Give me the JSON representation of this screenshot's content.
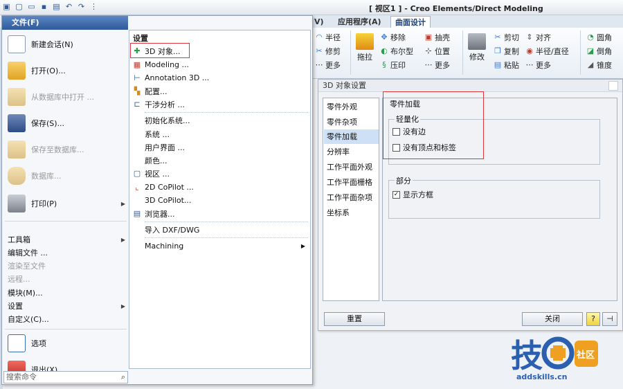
{
  "app": {
    "title": "[ 视区1 ] - Creo Elements/Direct Modeling"
  },
  "ribbon": {
    "tabs": [
      {
        "label": "V)"
      },
      {
        "label": "应用程序(A)"
      },
      {
        "label": "曲面设计",
        "active": true
      }
    ],
    "buttons": {
      "radius": "半径",
      "trim": "修剪",
      "more1": "更多",
      "move": "移除",
      "boolean": "布尔型",
      "compress": "压印",
      "pull": "拖拉",
      "shell": "抽壳",
      "position": "位置",
      "more2": "更多",
      "modify": "修改",
      "cut": "剪切",
      "copy": "复制",
      "paste": "粘贴",
      "align": "对齐",
      "radius_diameter": "半径/直径",
      "more3": "更多",
      "round": "圆角",
      "chamfer": "倒角",
      "taper": "锥度"
    }
  },
  "file_menu": {
    "tab_label": "文件(F)",
    "left_big": [
      {
        "label": "新建会话(N)",
        "icon": "new-session-icon",
        "disabled": false
      },
      {
        "label": "打开(O)...",
        "icon": "open-folder-icon",
        "disabled": false
      },
      {
        "label": "从数据库中打开 ...",
        "icon": "db-open-icon",
        "disabled": true
      },
      {
        "label": "保存(S)...",
        "icon": "save-icon",
        "disabled": false
      },
      {
        "label": "保存至数据库...",
        "icon": "db-save-icon",
        "disabled": true
      },
      {
        "label": "数据库...",
        "icon": "database-icon",
        "disabled": true
      },
      {
        "label": "打印(P)",
        "icon": "print-icon",
        "disabled": false
      }
    ],
    "left_small": [
      {
        "label": "工具箱",
        "disabled": false,
        "submenu": true
      },
      {
        "label": "编辑文件 ...",
        "disabled": false,
        "submenu": false
      },
      {
        "label": "渲染至文件",
        "disabled": true,
        "submenu": false
      },
      {
        "label": "远程...",
        "disabled": true,
        "submenu": false
      },
      {
        "label": "模块(M)...",
        "disabled": false,
        "submenu": false
      },
      {
        "label": "设置",
        "disabled": false,
        "submenu": true
      },
      {
        "label": "自定义(C)...",
        "disabled": false,
        "submenu": false
      }
    ],
    "left_bottom": [
      {
        "label": "选项",
        "icon": "options-icon"
      },
      {
        "label": "退出(X)",
        "icon": "exit-icon"
      }
    ],
    "search_placeholder": "搜索命令",
    "settings": {
      "header": "设置",
      "items": [
        {
          "label": "3D 对象...",
          "icon": "3d-object-icon",
          "highlighted": true
        },
        {
          "label": "Modeling ...",
          "icon": "modeling-icon"
        },
        {
          "label": "Annotation 3D ...",
          "icon": "annotation-icon"
        },
        {
          "label": "配置...",
          "icon": "config-icon"
        },
        {
          "label": "干涉分析 ...",
          "icon": "interference-icon"
        },
        {
          "label": "初始化系统...",
          "icon": ""
        },
        {
          "label": "系统 ...",
          "icon": ""
        },
        {
          "label": "用户界面 ...",
          "icon": ""
        },
        {
          "label": "颜色...",
          "icon": ""
        },
        {
          "label": "视区 ...",
          "icon": "viewport-icon"
        },
        {
          "label": "2D CoPilot ...",
          "icon": "copilot2d-icon"
        },
        {
          "label": "3D CoPilot...",
          "icon": ""
        },
        {
          "label": "浏览器...",
          "icon": "browser-icon"
        },
        {
          "label": "导入 DXF/DWG",
          "icon": ""
        },
        {
          "label": "Machining",
          "icon": "",
          "submenu": true
        }
      ]
    }
  },
  "dialog": {
    "title": "3D 对象设置",
    "nav": [
      {
        "label": "零件外观",
        "selected": false
      },
      {
        "label": "零件杂项",
        "selected": false
      },
      {
        "label": "零件加载",
        "selected": true
      },
      {
        "label": "分辨率",
        "selected": false
      },
      {
        "label": "工作平面外观",
        "selected": false
      },
      {
        "label": "工作平面栅格",
        "selected": false
      },
      {
        "label": "工作平面杂项",
        "selected": false
      },
      {
        "label": "坐标系",
        "selected": false
      }
    ],
    "panel_title": "零件加载",
    "lightweight_group": "轻量化",
    "lightweight_options": [
      {
        "label": "没有边",
        "checked": false
      },
      {
        "label": "没有顶点和标签",
        "checked": false
      }
    ],
    "partial_group": "部分",
    "partial_options": [
      {
        "label": "显示方框",
        "checked": true
      }
    ],
    "reset_label": "重置",
    "close_label": "关闭",
    "help_label": "?",
    "pin_label": "⊣"
  },
  "watermark": {
    "main_text": "技",
    "badge_text": "社区",
    "domain": "addskills.cn"
  },
  "colors": {
    "accent": "#2e5a9c",
    "highlight_red": "#d9373b",
    "selected_bg": "#cde0f5",
    "watermark_blue": "#2b5fb0",
    "watermark_orange": "#f0a020"
  }
}
